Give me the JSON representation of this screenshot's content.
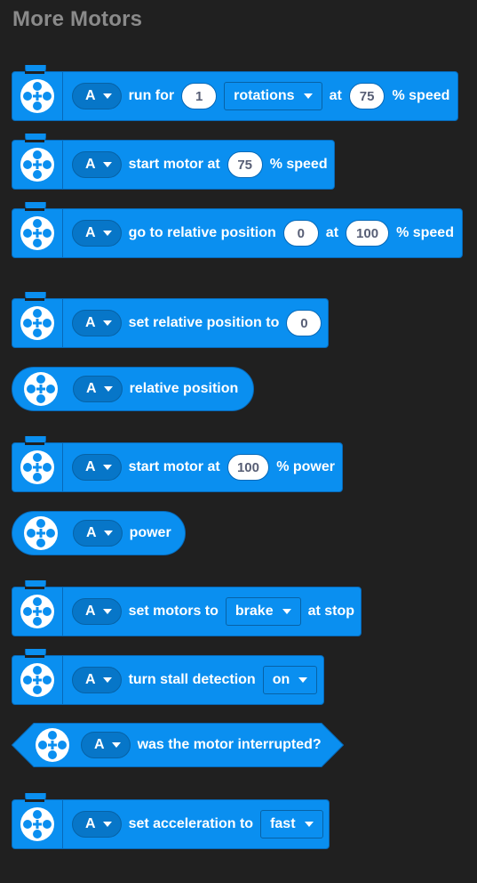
{
  "header": {
    "title": "More Motors"
  },
  "colors": {
    "block_blue": "#0a8ff0",
    "block_border": "#0769b8",
    "background": "#202020",
    "title_gray": "#8a8a8a"
  },
  "icon": "motor-icon",
  "blocks": {
    "run_for": {
      "port": "A",
      "t1": "run for",
      "amount": "1",
      "unit": "rotations",
      "t2": "at",
      "speed": "75",
      "t3": "% speed"
    },
    "start_speed": {
      "port": "A",
      "t1": "start motor at",
      "speed": "75",
      "t2": "% speed"
    },
    "go_relative": {
      "port": "A",
      "t1": "go to relative position",
      "position": "0",
      "t2": "at",
      "speed": "100",
      "t3": "% speed"
    },
    "set_relative": {
      "port": "A",
      "t1": "set relative position to",
      "position": "0"
    },
    "relative_reporter": {
      "port": "A",
      "t1": "relative position"
    },
    "start_power": {
      "port": "A",
      "t1": "start motor at",
      "power": "100",
      "t2": "% power"
    },
    "power_reporter": {
      "port": "A",
      "t1": "power"
    },
    "set_motors": {
      "port": "A",
      "t1": "set motors to",
      "mode": "brake",
      "t2": "at stop"
    },
    "stall": {
      "port": "A",
      "t1": "turn stall detection",
      "state": "on"
    },
    "interrupted": {
      "port": "A",
      "t1": "was the motor interrupted?"
    },
    "acceleration": {
      "port": "A",
      "t1": "set acceleration to",
      "value": "fast"
    }
  }
}
